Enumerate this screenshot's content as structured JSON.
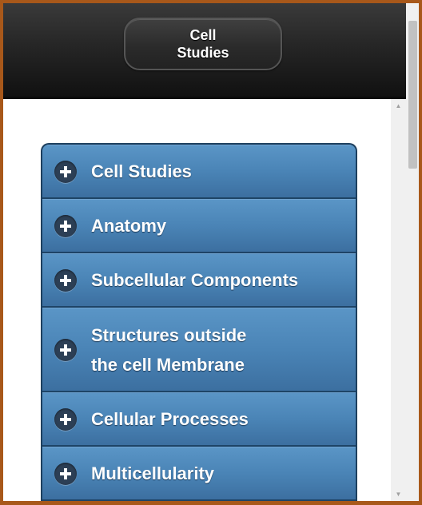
{
  "header": {
    "button_label": "Cell\nStudies"
  },
  "menu": {
    "items": [
      {
        "label": "Cell Studies",
        "icon": "plus-icon"
      },
      {
        "label": "Anatomy",
        "icon": "plus-icon"
      },
      {
        "label": "Subcellular Components",
        "icon": "plus-icon"
      },
      {
        "label": "Structures outside\nthe cell Membrane",
        "icon": "plus-icon"
      },
      {
        "label": "Cellular Processes",
        "icon": "plus-icon"
      },
      {
        "label": "Multicellularity",
        "icon": "plus-icon"
      }
    ]
  },
  "colors": {
    "header_bg": "#1a1a1a",
    "menu_item_bg": "#4a84b6",
    "window_border": "#a8581a"
  }
}
